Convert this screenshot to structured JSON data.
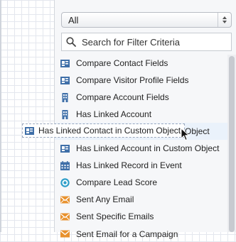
{
  "filter_select": {
    "value": "All"
  },
  "search": {
    "placeholder": "Search for Filter Criteria",
    "value": ""
  },
  "criteria": [
    {
      "label": "Compare Contact Fields",
      "icon": "contact-card-icon"
    },
    {
      "label": "Compare Visitor Profile Fields",
      "icon": "contact-card-icon"
    },
    {
      "label": "Compare Account Fields",
      "icon": "building-icon"
    },
    {
      "label": "Has Linked Account",
      "icon": "building-icon"
    },
    {
      "label": "Object",
      "icon": "none"
    },
    {
      "label": "Has Linked Account in Custom Object",
      "icon": "contact-card-icon"
    },
    {
      "label": "Has Linked Record in Event",
      "icon": "calendar-icon"
    },
    {
      "label": "Compare Lead Score",
      "icon": "target-icon"
    },
    {
      "label": "Sent Any Email",
      "icon": "email-icon"
    },
    {
      "label": "Sent Specific Emails",
      "icon": "email-icon"
    },
    {
      "label": "Sent Email for a Campaign",
      "icon": "email-icon"
    }
  ],
  "dragged_item": {
    "label": "Has Linked Contact in Custom Object",
    "icon": "contact-card-icon"
  },
  "colors": {
    "icon_blue": "#3f6fa8",
    "icon_orange": "#e8912d",
    "icon_teal": "#2e9ec9",
    "highlight": "#eaf2fb"
  }
}
